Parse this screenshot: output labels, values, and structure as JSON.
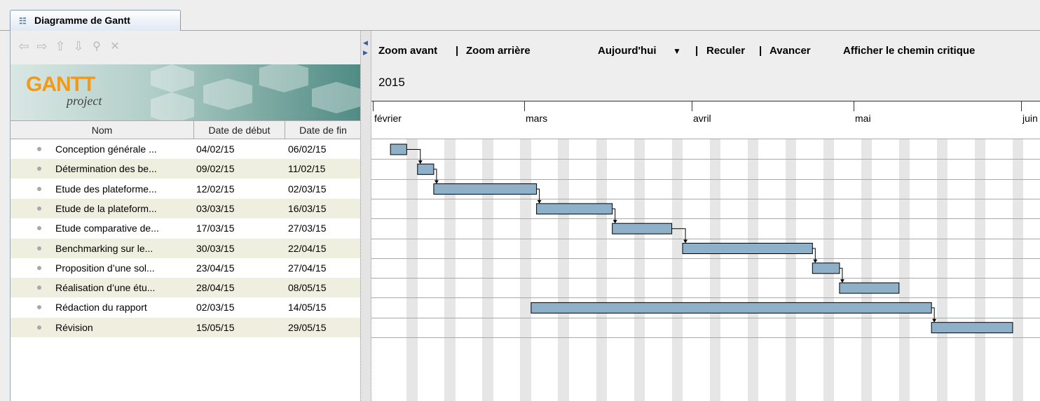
{
  "tab": {
    "title": "Diagramme de Gantt",
    "icon": "gantt-tab-icon"
  },
  "toolbar": {
    "icons": [
      "arrow-left-icon",
      "arrow-right-icon",
      "arrow-up-icon",
      "arrow-down-icon",
      "link-icon",
      "unlink-icon"
    ]
  },
  "logo": {
    "main": "GANTT",
    "sub": "project"
  },
  "table": {
    "headers": {
      "name": "Nom",
      "start": "Date de début",
      "end": "Date de fin"
    },
    "rows": [
      {
        "name": "Conception générale ...",
        "start": "04/02/15",
        "end": "06/02/15"
      },
      {
        "name": "Détermination des be...",
        "start": "09/02/15",
        "end": "11/02/15"
      },
      {
        "name": "Etude des plateforme...",
        "start": "12/02/15",
        "end": "02/03/15"
      },
      {
        "name": "Etude de la plateform...",
        "start": "03/03/15",
        "end": "16/03/15"
      },
      {
        "name": "Etude comparative de...",
        "start": "17/03/15",
        "end": "27/03/15"
      },
      {
        "name": "Benchmarking sur le...",
        "start": "30/03/15",
        "end": "22/04/15"
      },
      {
        "name": "Proposition d’une sol...",
        "start": "23/04/15",
        "end": "27/04/15"
      },
      {
        "name": "Réalisation d’une étu...",
        "start": "28/04/15",
        "end": "08/05/15"
      },
      {
        "name": "Rédaction du rapport",
        "start": "02/03/15",
        "end": "14/05/15"
      },
      {
        "name": "Révision",
        "start": "15/05/15",
        "end": "29/05/15"
      }
    ]
  },
  "chart_toolbar": {
    "zoom_in": "Zoom avant",
    "sep1": "|",
    "zoom_out": "Zoom arrière",
    "today": "Aujourd'hui",
    "today_arrow": "▼",
    "sep2": "|",
    "back": "Reculer",
    "sep3": "|",
    "forward": "Avancer",
    "critical_path": "Afficher le chemin critique"
  },
  "timeline": {
    "year": "2015",
    "months": [
      "février",
      "mars",
      "avril",
      "mai",
      "juin"
    ]
  },
  "colors": {
    "bar_fill": "#8fb0c9",
    "bar_stroke": "#000000",
    "weekend": "#e6e6e6"
  },
  "chart_data": {
    "type": "gantt",
    "view_start": "2015-02-01",
    "tasks": [
      {
        "start": "2015-02-04",
        "end": "2015-02-06"
      },
      {
        "start": "2015-02-09",
        "end": "2015-02-11"
      },
      {
        "start": "2015-02-12",
        "end": "2015-03-02"
      },
      {
        "start": "2015-03-03",
        "end": "2015-03-16"
      },
      {
        "start": "2015-03-17",
        "end": "2015-03-27"
      },
      {
        "start": "2015-03-30",
        "end": "2015-04-22"
      },
      {
        "start": "2015-04-23",
        "end": "2015-04-27"
      },
      {
        "start": "2015-04-28",
        "end": "2015-05-08"
      },
      {
        "start": "2015-03-02",
        "end": "2015-05-14"
      },
      {
        "start": "2015-05-15",
        "end": "2015-05-29"
      }
    ],
    "dependencies": [
      [
        0,
        1
      ],
      [
        1,
        2
      ],
      [
        2,
        3
      ],
      [
        3,
        4
      ],
      [
        4,
        5
      ],
      [
        5,
        6
      ],
      [
        6,
        7
      ],
      [
        8,
        9
      ]
    ]
  }
}
